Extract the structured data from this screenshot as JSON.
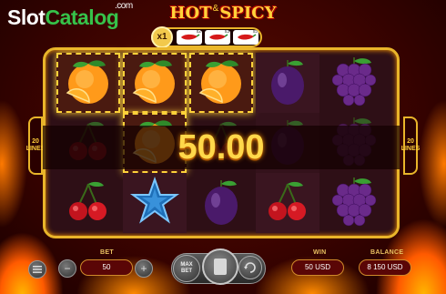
{
  "watermark": {
    "slot": "Slot",
    "catalog": "Catalog",
    "dotcom": ".com"
  },
  "game_logo": {
    "hot": "HOT",
    "amp": "&",
    "spicy": "SPICY"
  },
  "multiplier": {
    "badge": "x1",
    "chili_levels": [
      "x2",
      "x3",
      "x5"
    ]
  },
  "lines": {
    "count": "20",
    "word": "LINES"
  },
  "reels": [
    [
      "orange",
      "cherry",
      "cherry"
    ],
    [
      "orange",
      "orange",
      "star"
    ],
    [
      "orange",
      "cherry",
      "plum"
    ],
    [
      "plum",
      "plum",
      "cherry"
    ],
    [
      "grapes",
      "grapes",
      "grapes"
    ]
  ],
  "winning_cells": [
    [
      0,
      0
    ],
    [
      1,
      0
    ],
    [
      2,
      0
    ],
    [
      1,
      1
    ]
  ],
  "win_amount": "50.00",
  "controls": {
    "bet_label": "BET",
    "bet_value": "50",
    "minus": "−",
    "plus": "+",
    "max_bet_top": "MAX",
    "max_bet_bottom": "BET",
    "win_label": "WIN",
    "win_value": "50 USD",
    "balance_label": "BALANCE",
    "balance_value": "8 150 USD"
  },
  "colors": {
    "frame_gold": "#e9b52a",
    "win_text": "#ffd84a",
    "catalog_green": "#36c24a"
  }
}
